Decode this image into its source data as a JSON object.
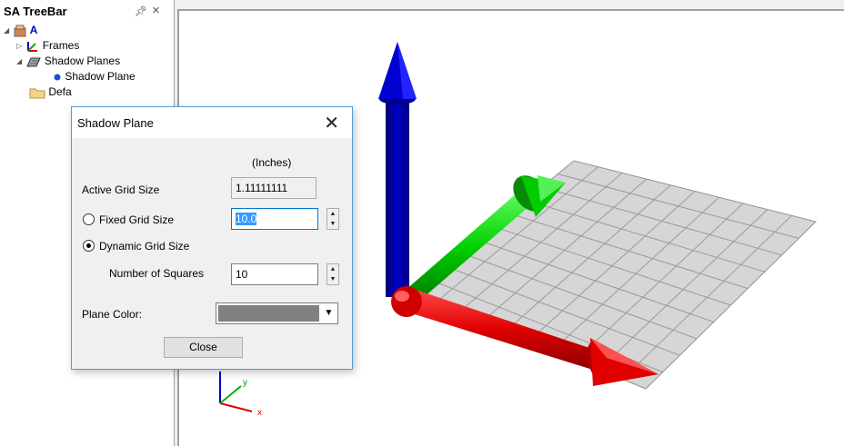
{
  "treebar": {
    "title": "SA TreeBar",
    "items": [
      {
        "label": "A",
        "icon": "collection-icon"
      },
      {
        "label": "Frames",
        "icon": "frames-icon"
      },
      {
        "label": "Shadow Planes",
        "icon": "plane-icon"
      },
      {
        "label": "Shadow Plane",
        "icon": "dot-icon"
      },
      {
        "label": "Defa",
        "icon": "folder-icon"
      }
    ]
  },
  "dialog": {
    "title": "Shadow Plane",
    "units_label": "(Inches)",
    "active_grid_label": "Active Grid Size",
    "active_grid_value": "1.11111111",
    "fixed_grid_label": "Fixed Grid Size",
    "fixed_grid_value": "10.0",
    "dynamic_grid_label": "Dynamic Grid Size",
    "squares_label": "Number of Squares",
    "squares_value": "10",
    "plane_color_label": "Plane Color:",
    "plane_color": "#808080",
    "close_label": "Close",
    "selected_mode": "dynamic"
  },
  "scene": {
    "axis_colors": {
      "x": "#e00000",
      "y": "#00c000",
      "z": "#0000c0"
    },
    "triad_labels": {
      "x": "x",
      "y": "y"
    }
  }
}
